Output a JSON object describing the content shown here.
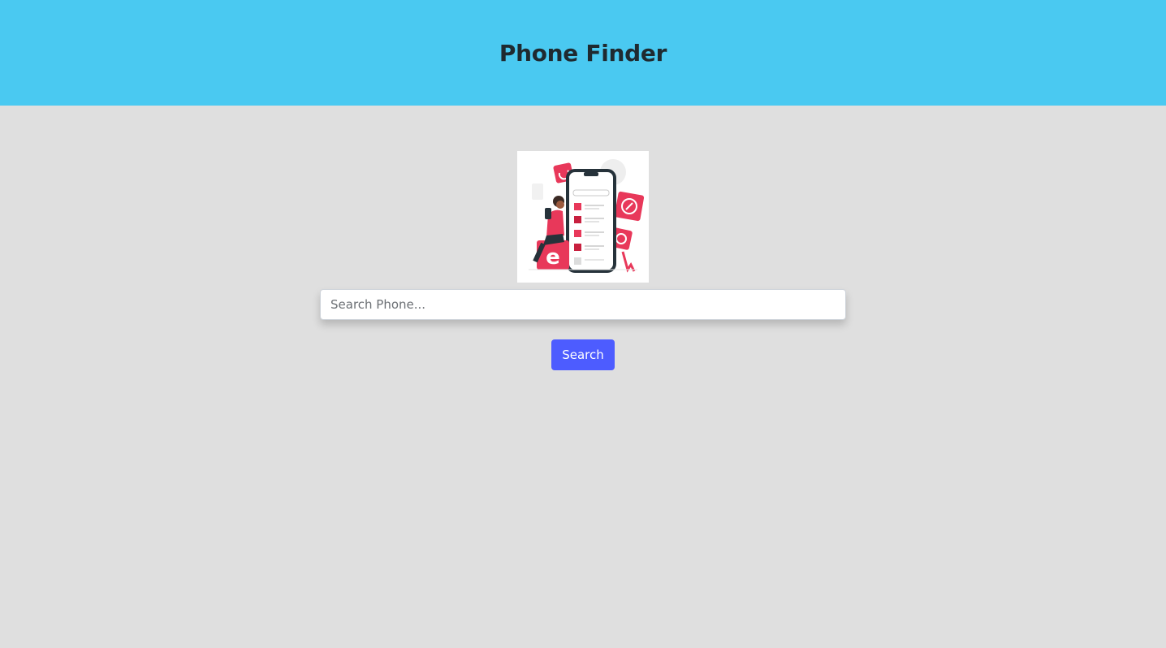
{
  "header": {
    "title": "Phone Finder",
    "background_color": "#4ac9f1"
  },
  "hero": {
    "image_icon": "phone-search-illustration-icon",
    "accent_color": "#e8385a"
  },
  "search": {
    "placeholder": "Search Phone...",
    "value": "",
    "button_label": "Search",
    "button_color": "#4d5cff"
  },
  "page": {
    "background_color": "#dfdfdf"
  }
}
